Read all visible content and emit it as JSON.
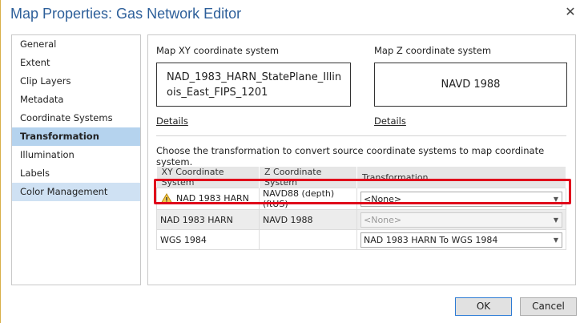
{
  "window": {
    "title": "Map Properties: Gas Network Editor"
  },
  "nav": {
    "items": [
      {
        "label": "General"
      },
      {
        "label": "Extent"
      },
      {
        "label": "Clip Layers"
      },
      {
        "label": "Metadata"
      },
      {
        "label": "Coordinate Systems"
      },
      {
        "label": "Transformation"
      },
      {
        "label": "Illumination"
      },
      {
        "label": "Labels"
      },
      {
        "label": "Color Management"
      }
    ],
    "selected": "Transformation"
  },
  "xy": {
    "heading": "Map XY coordinate system",
    "value": "NAD_1983_HARN_StatePlane_Illinois_East_FIPS_1201",
    "line1": "NAD_1983_HARN_StatePlane_Illin",
    "line2": "ois_East_FIPS_1201",
    "details": "Details"
  },
  "z": {
    "heading": "Map Z coordinate system",
    "value": "NAVD 1988",
    "details": "Details"
  },
  "instruction": "Choose the transformation to convert source coordinate systems to map coordinate system.",
  "table": {
    "columns": [
      "XY Coordinate System",
      "Z Coordinate System",
      "Transformation"
    ],
    "rows": [
      {
        "xy": "NAD 1983 HARN",
        "z": "NAVD88 (depth) (ftUS)",
        "transformation": "<None>",
        "warning": true,
        "disabled": false
      },
      {
        "xy": "NAD 1983 HARN",
        "z": "NAVD 1988",
        "transformation": "<None>",
        "warning": false,
        "disabled": true
      },
      {
        "xy": "WGS 1984",
        "z": "",
        "transformation": "NAD 1983 HARN To WGS 1984",
        "warning": false,
        "disabled": false
      }
    ]
  },
  "buttons": {
    "ok": "OK",
    "cancel": "Cancel"
  },
  "colors": {
    "accent": "#2d5f9a",
    "selected": "#b5d3ee",
    "highlight": "#e0001b"
  }
}
